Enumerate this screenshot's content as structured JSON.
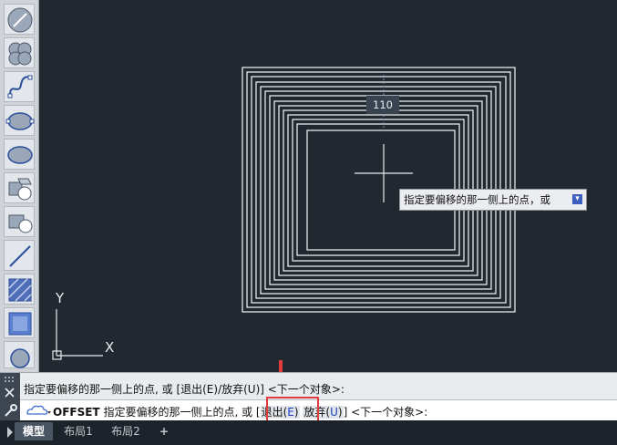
{
  "toolbar": {
    "tools": [
      {
        "name": "line-tool-icon"
      },
      {
        "name": "cloud-tool-icon"
      },
      {
        "name": "spline-tool-icon"
      },
      {
        "name": "ellipse-tool-icon"
      },
      {
        "name": "ellipse2-tool-icon"
      },
      {
        "name": "block-insert-icon"
      },
      {
        "name": "block-create-icon"
      },
      {
        "name": "xline-tool-icon"
      },
      {
        "name": "hatch-tool-icon"
      },
      {
        "name": "gradient-tool-icon"
      },
      {
        "name": "region-tool-icon"
      }
    ]
  },
  "canvas": {
    "ucs_x": "X",
    "ucs_y": "Y",
    "dimension_value": "110",
    "cursor_hint": "指定要偏移的那一侧上的点，或"
  },
  "command": {
    "history": "指定要偏移的那一侧上的点, 或 [退出(E)/放弃(U)] <下一个对象>:",
    "command_name": "OFFSET",
    "prompt": "指定要偏移的那一侧上的点, 或",
    "bracket_open": "[",
    "option_exit": "退出(",
    "option_exit_key": "E",
    "option_close": ")",
    "option_undo": "放弃(",
    "option_undo_key": "U",
    "bracket_close": "]",
    "suffix": "<下一个对象>:"
  },
  "tabs": [
    {
      "label": "模型"
    },
    {
      "label": "布局1"
    },
    {
      "label": "布局2"
    },
    {
      "label": "+"
    }
  ],
  "colors": {
    "canvas_bg": "#212830",
    "highlight_box": "#e23b3b",
    "arrow": "#e23b3b"
  }
}
